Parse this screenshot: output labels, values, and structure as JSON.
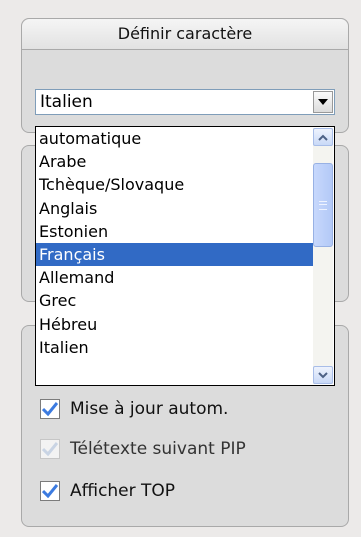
{
  "section": {
    "title": "Définir caractère"
  },
  "charset_select": {
    "selected": "Italien",
    "options": [
      "automatique",
      "Arabe",
      "Tchèque/Slovaque",
      "Anglais",
      "Estonien",
      "Français",
      "Allemand",
      "Grec",
      "Hébreu",
      "Italien"
    ],
    "highlighted": "Français"
  },
  "options": {
    "auto_update": {
      "label": "Mise à jour autom.",
      "checked": true,
      "enabled": true
    },
    "teletext_pip": {
      "label": "Télétexte suivant PIP",
      "checked": true,
      "enabled": false
    },
    "show_top": {
      "label": "Afficher TOP",
      "checked": true,
      "enabled": true
    }
  }
}
